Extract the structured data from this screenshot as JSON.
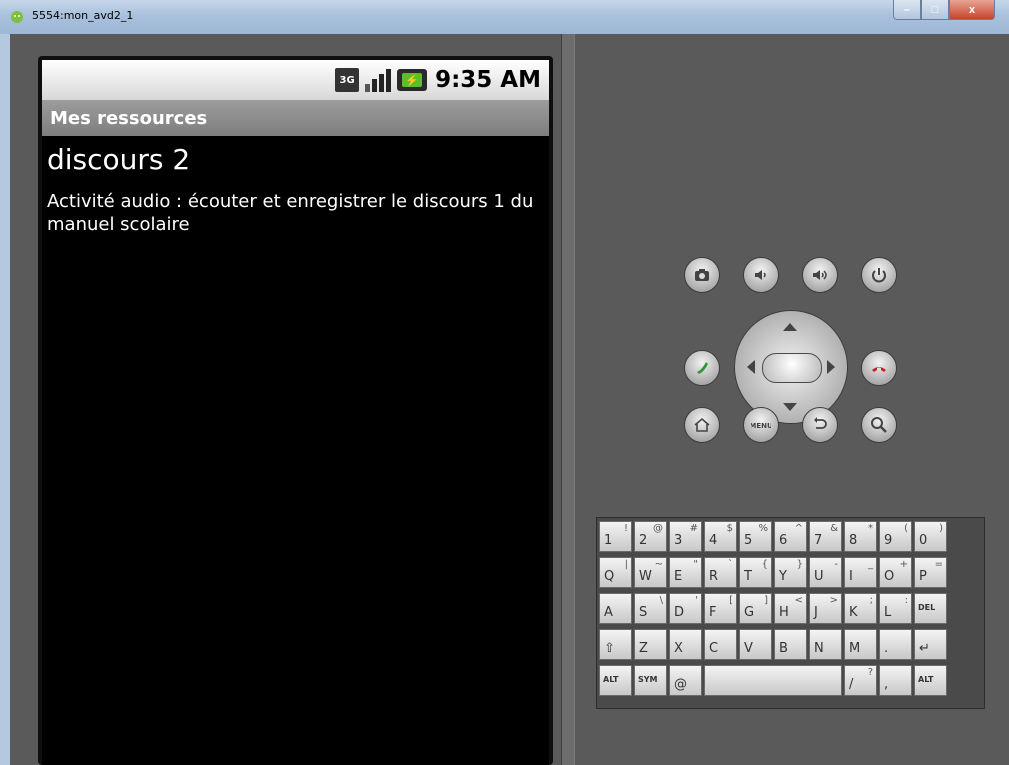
{
  "window": {
    "title": "5554:mon_avd2_1",
    "min_label": "–",
    "max_label": "□",
    "close_label": "x"
  },
  "status_bar": {
    "network_label": "3G",
    "time": "9:35 AM"
  },
  "app": {
    "title": "Mes ressources",
    "resource_title": "discours 2",
    "resource_description": "Activité audio : écouter et enregistrer le discours 1 du manuel scolaire"
  },
  "keyboard": {
    "row1": [
      [
        "1",
        "!"
      ],
      [
        "2",
        "@"
      ],
      [
        "3",
        "#"
      ],
      [
        "4",
        "$"
      ],
      [
        "5",
        "%"
      ],
      [
        "6",
        "^"
      ],
      [
        "7",
        "&"
      ],
      [
        "8",
        "*"
      ],
      [
        "9",
        "("
      ],
      [
        "0",
        ")"
      ]
    ],
    "row2": [
      [
        "Q",
        "|"
      ],
      [
        "W",
        "~"
      ],
      [
        "E",
        "\""
      ],
      [
        "R",
        "`"
      ],
      [
        "T",
        "{"
      ],
      [
        "Y",
        "}"
      ],
      [
        "U",
        "-"
      ],
      [
        "I",
        "_"
      ],
      [
        "O",
        "+"
      ],
      [
        "P",
        "="
      ]
    ],
    "row3": [
      [
        "A",
        ""
      ],
      [
        "S",
        "\\"
      ],
      [
        "D",
        "'"
      ],
      [
        "F",
        "["
      ],
      [
        "G",
        "]"
      ],
      [
        "H",
        "<"
      ],
      [
        "J",
        ">"
      ],
      [
        "K",
        ";"
      ],
      [
        "L",
        ":"
      ],
      [
        "DEL",
        ""
      ]
    ],
    "row4": [
      [
        "⇧",
        ""
      ],
      [
        "Z",
        ""
      ],
      [
        "X",
        ""
      ],
      [
        "C",
        ""
      ],
      [
        "V",
        ""
      ],
      [
        "B",
        ""
      ],
      [
        "N",
        ""
      ],
      [
        "M",
        ""
      ],
      [
        ".",
        ""
      ],
      [
        "↵",
        ""
      ]
    ],
    "row5": [
      [
        "ALT",
        ""
      ],
      [
        "SYM",
        ""
      ],
      [
        "@",
        ""
      ],
      [
        "",
        ""
      ],
      [
        "/",
        "?"
      ],
      [
        ",",
        ""
      ],
      [
        "ALT",
        ""
      ]
    ]
  },
  "colors": {
    "battery": "#5cbf2a",
    "call": "#2e9a2e",
    "end_call": "#c82020"
  }
}
